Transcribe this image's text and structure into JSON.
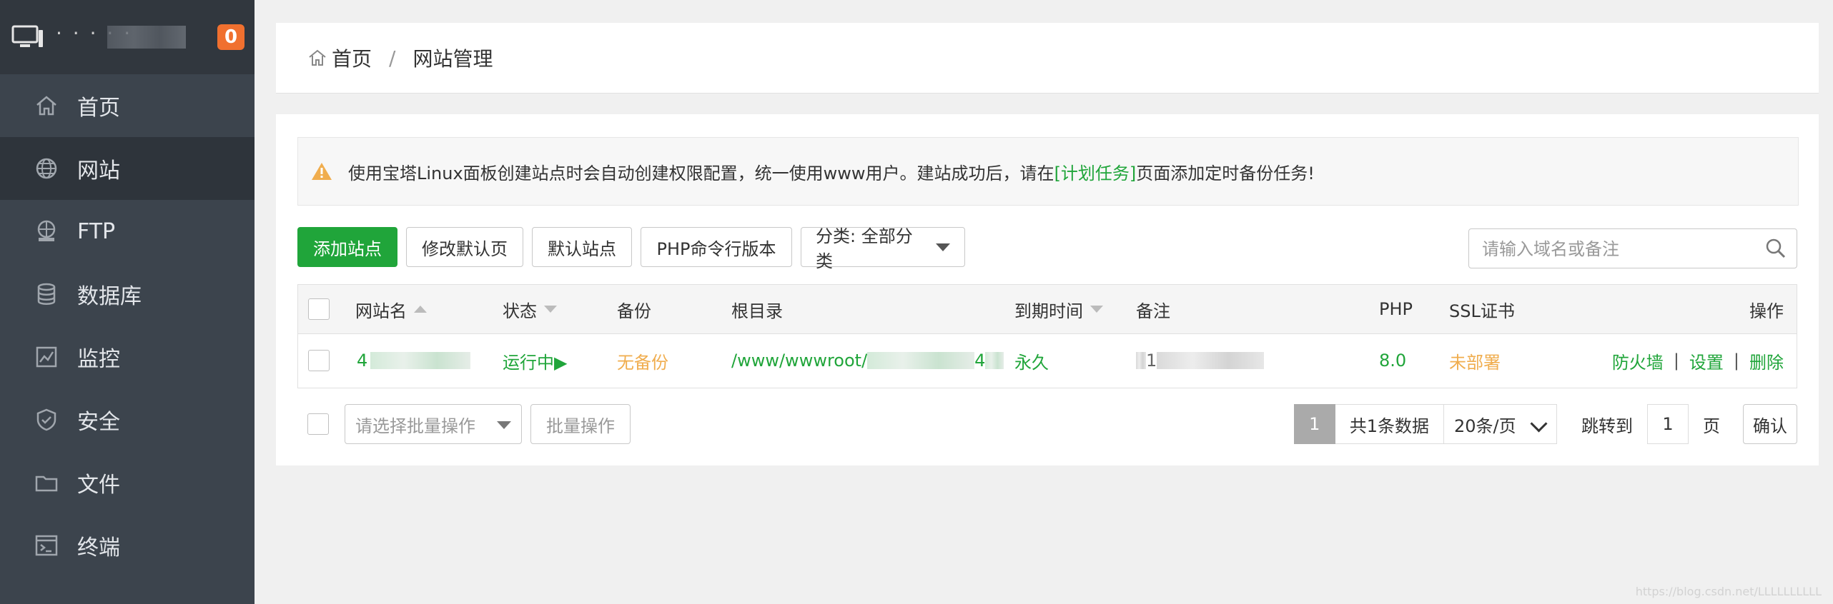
{
  "sidebar": {
    "server_name": "· · · · ·",
    "badge_count": "0",
    "items": [
      {
        "label": "首页",
        "icon": "home-icon"
      },
      {
        "label": "网站",
        "icon": "globe-icon"
      },
      {
        "label": "FTP",
        "icon": "ftp-icon"
      },
      {
        "label": "数据库",
        "icon": "database-icon"
      },
      {
        "label": "监控",
        "icon": "monitor-chart-icon"
      },
      {
        "label": "安全",
        "icon": "shield-icon"
      },
      {
        "label": "文件",
        "icon": "folder-icon"
      },
      {
        "label": "终端",
        "icon": "terminal-icon"
      }
    ],
    "active_index": 1
  },
  "breadcrumb": {
    "home": "首页",
    "separator": "/",
    "current": "网站管理"
  },
  "notice": {
    "text_before": "使用宝塔Linux面板创建站点时会自动创建权限配置，统一使用www用户。建站成功后，请在",
    "link": "[计划任务]",
    "text_after": "页面添加定时备份任务!"
  },
  "toolbar": {
    "add_site": "添加站点",
    "modify_default_page": "修改默认页",
    "default_site": "默认站点",
    "php_cli_version": "PHP命令行版本",
    "category_select": "分类: 全部分类"
  },
  "search": {
    "placeholder": "请输入域名或备注"
  },
  "table": {
    "headers": {
      "site_name": "网站名",
      "status": "状态",
      "backup": "备份",
      "root_dir": "根目录",
      "expire": "到期时间",
      "remark": "备注",
      "php": "PHP",
      "ssl": "SSL证书",
      "actions": "操作"
    },
    "rows": [
      {
        "site_name": "4",
        "status": "运行中▶",
        "backup": "无备份",
        "root_dir": "/www/wwwroot/",
        "root_dir_tail": "4",
        "expire": "永久",
        "remark": "1",
        "php": "8.0",
        "ssl": "未部署",
        "action_firewall": "防火墙",
        "action_settings": "设置",
        "action_delete": "删除",
        "separator": "|"
      }
    ]
  },
  "footer": {
    "batch_select_placeholder": "请选择批量操作",
    "batch_button": "批量操作",
    "current_page": "1",
    "total": "共1条数据",
    "page_size": "20条/页",
    "jump_label": "跳转到",
    "jump_value": "1",
    "jump_unit": "页",
    "confirm": "确认"
  },
  "watermark": "https://blog.csdn.net/LLLLLLLLLL",
  "colors": {
    "sidebar_bg": "#3c444d",
    "sidebar_active_bg": "#2e343b",
    "accent_green": "#20a53a",
    "warning_orange": "#f0ad4e",
    "badge_orange": "#f0702f"
  }
}
